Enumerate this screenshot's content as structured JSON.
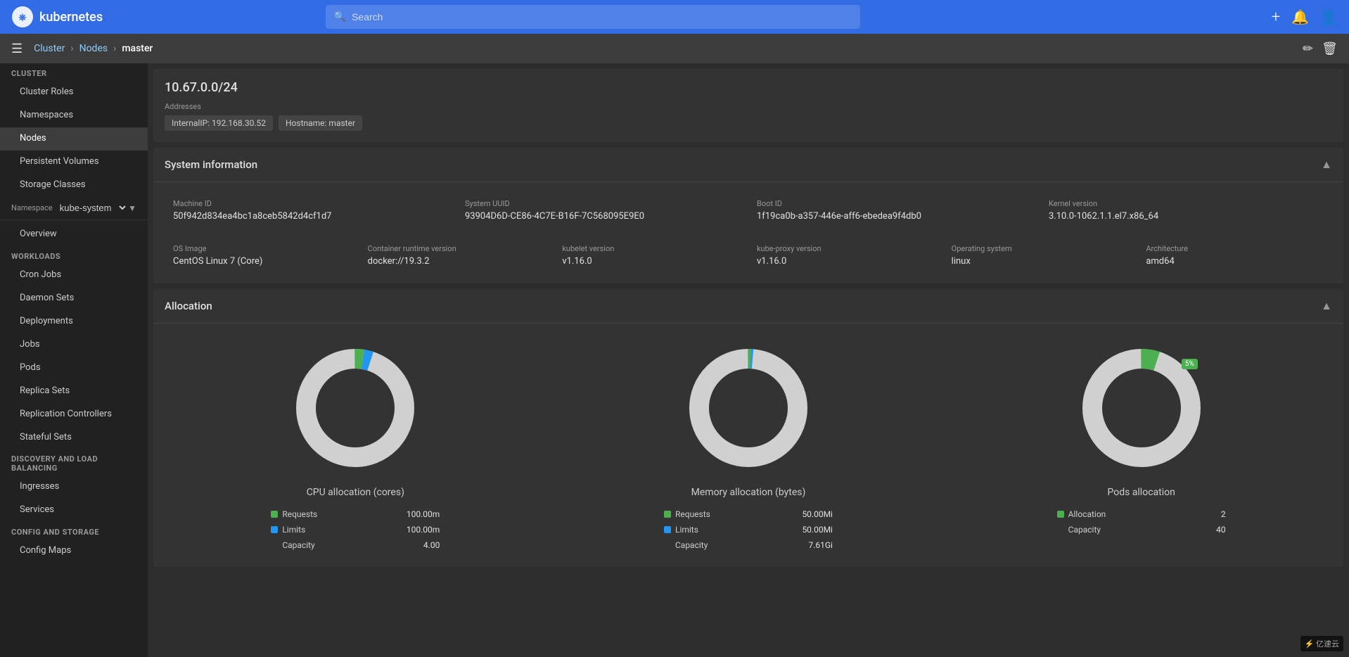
{
  "app": {
    "name": "kubernetes",
    "logo_alt": "Kubernetes logo"
  },
  "topnav": {
    "search_placeholder": "Search",
    "add_icon": "+",
    "bell_icon": "🔔",
    "user_icon": "👤"
  },
  "breadcrumb": {
    "cluster": "Cluster",
    "nodes": "Nodes",
    "current": "master",
    "edit_icon": "✏",
    "delete_icon": "🗑"
  },
  "sidebar": {
    "cluster_section": "Cluster",
    "cluster_roles": "Cluster Roles",
    "namespaces": "Namespaces",
    "nodes": "Nodes",
    "persistent_volumes": "Persistent Volumes",
    "storage_classes": "Storage Classes",
    "namespace_section": "Namespace",
    "namespace_value": "kube-system",
    "overview": "Overview",
    "workloads_section": "Workloads",
    "cron_jobs": "Cron Jobs",
    "daemon_sets": "Daemon Sets",
    "deployments": "Deployments",
    "jobs": "Jobs",
    "pods": "Pods",
    "replica_sets": "Replica Sets",
    "replication_controllers": "Replication Controllers",
    "stateful_sets": "Stateful Sets",
    "discovery_section": "Discovery and Load Balancing",
    "ingresses": "Ingresses",
    "services": "Services",
    "config_section": "Config and Storage",
    "config_maps": "Config Maps"
  },
  "ip_address": "10.67.0.0/24",
  "addresses_label": "Addresses",
  "address_tags": [
    "InternalIP: 192.168.30.52",
    "Hostname: master"
  ],
  "system_info": {
    "title": "System information",
    "machine_id_label": "Machine ID",
    "machine_id_value": "50f942d834ea4bc1a8ceb5842d4cf1d7",
    "system_uuid_label": "System UUID",
    "system_uuid_value": "93904D6D-CE86-4C7E-B16F-7C568095E9E0",
    "boot_id_label": "Boot ID",
    "boot_id_value": "1f19ca0b-a357-446e-aff6-ebedea9f4db0",
    "kernel_version_label": "Kernel version",
    "kernel_version_value": "3.10.0-1062.1.1.el7.x86_64",
    "os_image_label": "OS Image",
    "os_image_value": "CentOS Linux 7 (Core)",
    "container_runtime_label": "Container runtime version",
    "container_runtime_value": "docker://19.3.2",
    "kubelet_version_label": "kubelet version",
    "kubelet_version_value": "v1.16.0",
    "kube_proxy_label": "kube-proxy version",
    "kube_proxy_value": "v1.16.0",
    "operating_system_label": "Operating system",
    "operating_system_value": "linux",
    "architecture_label": "Architecture",
    "architecture_value": "amd64"
  },
  "allocation": {
    "title": "Allocation",
    "cpu": {
      "title": "CPU allocation (cores)",
      "requests_label": "Requests",
      "requests_value": "100.00m",
      "limits_label": "Limits",
      "limits_value": "100.00m",
      "capacity_label": "Capacity",
      "capacity_value": "4.00",
      "requests_color": "#4caf50",
      "limits_color": "#2196f3",
      "requests_pct": 2.5,
      "limits_pct": 2.5
    },
    "memory": {
      "title": "Memory allocation (bytes)",
      "requests_label": "Requests",
      "requests_value": "50.00Mi",
      "limits_label": "Limits",
      "limits_value": "50.00Mi",
      "capacity_label": "Capacity",
      "capacity_value": "7.61Gi",
      "requests_color": "#4caf50",
      "limits_color": "#2196f3",
      "requests_pct": 0.6,
      "limits_pct": 0.6
    },
    "pods": {
      "title": "Pods allocation",
      "allocation_label": "Allocation",
      "allocation_value": "2",
      "capacity_label": "Capacity",
      "capacity_value": "40",
      "allocation_color": "#4caf50",
      "pct": 5,
      "pct_label": "5%"
    }
  },
  "watermark": "亿速云"
}
